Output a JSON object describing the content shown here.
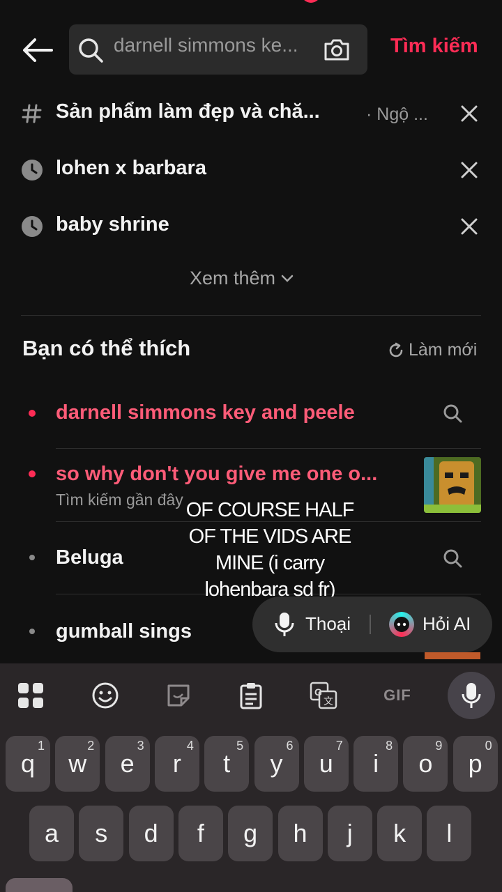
{
  "header": {
    "search_value": "darnell simmons ke...",
    "search_button": "Tìm kiếm"
  },
  "history": [
    {
      "type": "hashtag",
      "icon": "hash-icon",
      "text": "Sản phẩm làm đẹp và chă...",
      "tag": "· Ngộ ..."
    },
    {
      "type": "recent",
      "icon": "clock-icon",
      "text": "lohen x barbara"
    },
    {
      "type": "recent",
      "icon": "clock-icon",
      "text": "baby shrine"
    }
  ],
  "see_more": "Xem thêm",
  "suggestions_section": {
    "title": "Bạn có thể thích",
    "refresh_label": "Làm mới"
  },
  "suggestions": [
    {
      "text": "darnell simmons key and peele",
      "highlight": true
    },
    {
      "text": "so why don't you give me one o...",
      "sub": "Tìm kiếm gần đây",
      "highlight": true
    },
    {
      "text": "Beluga",
      "highlight": false
    },
    {
      "text": "gumball sings",
      "highlight": false
    }
  ],
  "overlay_caption": {
    "line1": "OF COURSE HALF",
    "line2": "OF THE VIDS ARE",
    "line3": "MINE (i carry",
    "line4": "lohenbara sd fr)"
  },
  "voice_bar": {
    "voice_label": "Thoại",
    "ai_label": "Hỏi AI"
  },
  "keyboard": {
    "toolbar": [
      "apps-grid-icon",
      "emoji-icon",
      "sticker-icon",
      "clipboard-icon",
      "translate-icon",
      "GIF",
      "mic-icon"
    ],
    "gif_label": "GIF",
    "row1": [
      {
        "k": "q",
        "n": "1"
      },
      {
        "k": "w",
        "n": "2"
      },
      {
        "k": "e",
        "n": "3"
      },
      {
        "k": "r",
        "n": "4"
      },
      {
        "k": "t",
        "n": "5"
      },
      {
        "k": "y",
        "n": "6"
      },
      {
        "k": "u",
        "n": "7"
      },
      {
        "k": "i",
        "n": "8"
      },
      {
        "k": "o",
        "n": "9"
      },
      {
        "k": "p",
        "n": "0"
      }
    ],
    "row2": [
      "a",
      "s",
      "d",
      "f",
      "g",
      "h",
      "j",
      "k",
      "l"
    ]
  },
  "colors": {
    "accent": "#fe2c55",
    "background": "#111111",
    "keyboard_bg": "#2a2628",
    "key_bg": "#4a4548"
  }
}
